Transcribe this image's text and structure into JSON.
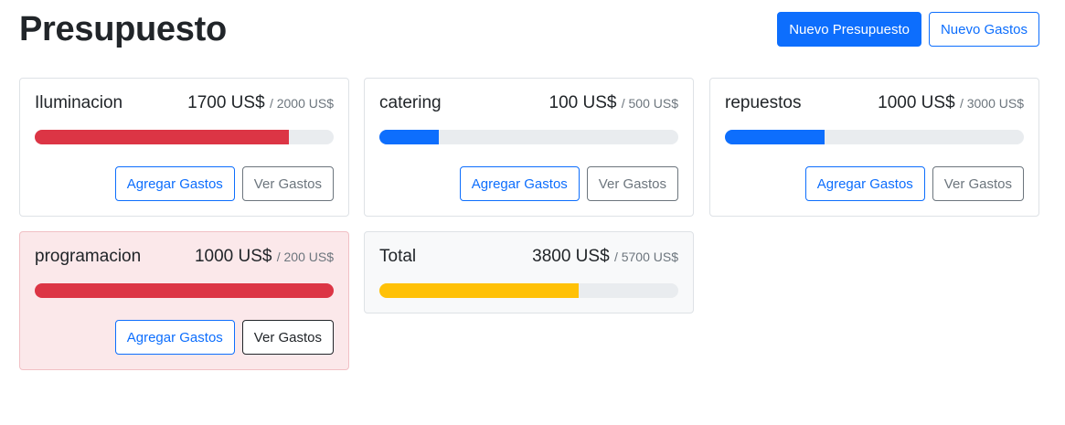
{
  "header": {
    "title": "Presupuesto",
    "new_budget_label": "Nuevo Presupuesto",
    "new_expenses_label": "Nuevo Gastos"
  },
  "budgets": [
    {
      "name": "Iluminacion",
      "spent": "1700 US$",
      "max": "/ 2000 US$",
      "progress": 0.85,
      "status": "danger"
    },
    {
      "name": "catering",
      "spent": "100 US$",
      "max": "/ 500 US$",
      "progress": 0.2,
      "status": "primary"
    },
    {
      "name": "repuestos",
      "spent": "1000 US$",
      "max": "/ 3000 US$",
      "progress": 0.3333,
      "status": "primary"
    },
    {
      "name": "programacion",
      "spent": "1000 US$",
      "max": "/ 200 US$",
      "progress": 1.0,
      "status": "danger"
    }
  ],
  "total": {
    "name": "Total",
    "spent": "3800 US$",
    "max": "/ 5700 US$",
    "progress": 0.6667,
    "status": "warning"
  },
  "card_actions": {
    "add_expense_label": "Agregar Gastos",
    "view_expenses_label": "Ver Gastos"
  },
  "colors": {
    "primary": "#0d6efd",
    "danger": "#dc3545",
    "warning": "#ffc107",
    "secondary": "#6c757d"
  }
}
